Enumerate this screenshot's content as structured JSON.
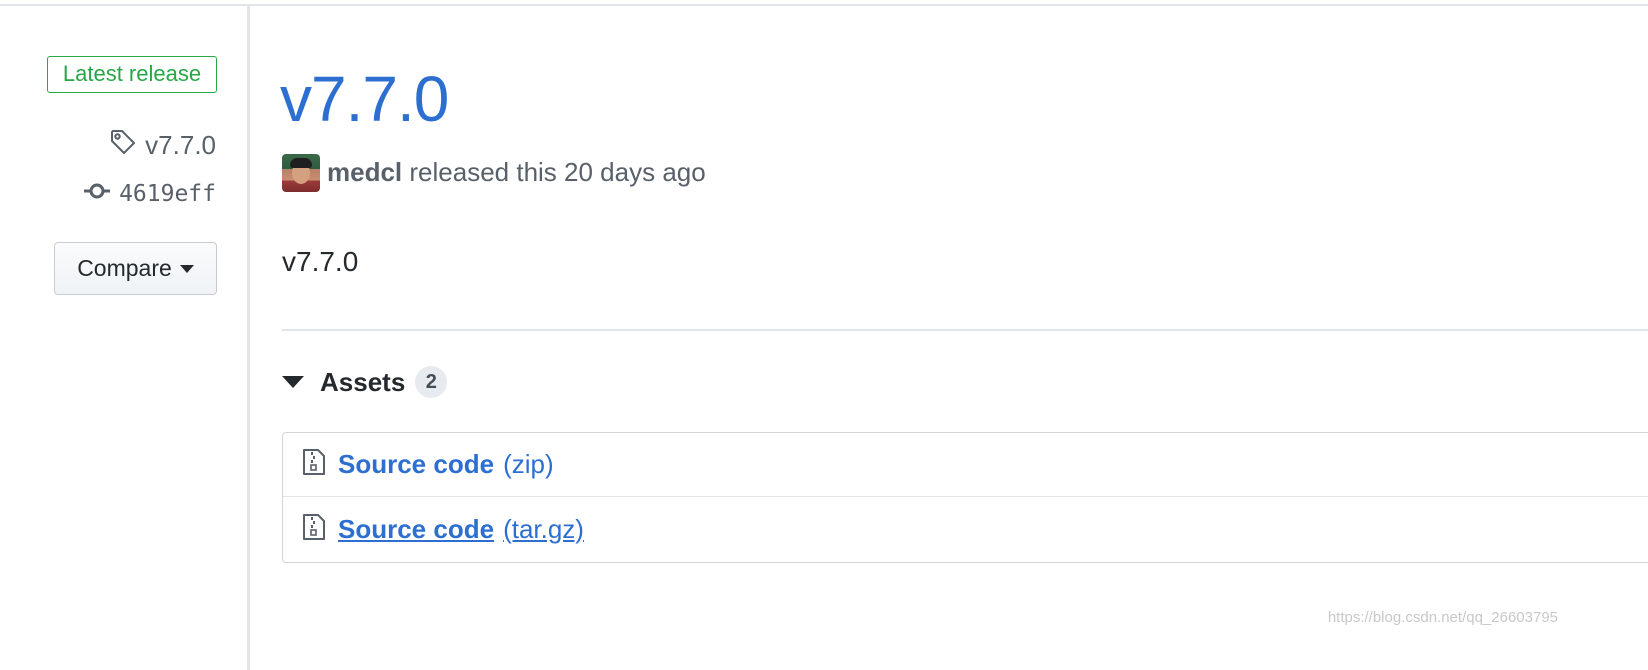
{
  "sidebar": {
    "badge": "Latest release",
    "tag": "v7.7.0",
    "commit": "4619eff",
    "compare_label": "Compare"
  },
  "release": {
    "title": "v7.7.0",
    "author": "medcl",
    "released_text": "released this 20 days ago",
    "body": "v7.7.0"
  },
  "assets": {
    "label": "Assets",
    "count": "2",
    "items": [
      {
        "name": "Source code",
        "ext": "(zip)"
      },
      {
        "name": "Source code",
        "ext": "(tar.gz)"
      }
    ]
  },
  "watermark": "https://blog.csdn.net/qq_26603795",
  "colors": {
    "link": "#2d6fd1",
    "badge_green": "#28a745",
    "muted": "#586069"
  },
  "icons": [
    "tag-icon",
    "commit-icon",
    "caret-down-icon",
    "triangle-down-icon",
    "file-zip-icon"
  ]
}
